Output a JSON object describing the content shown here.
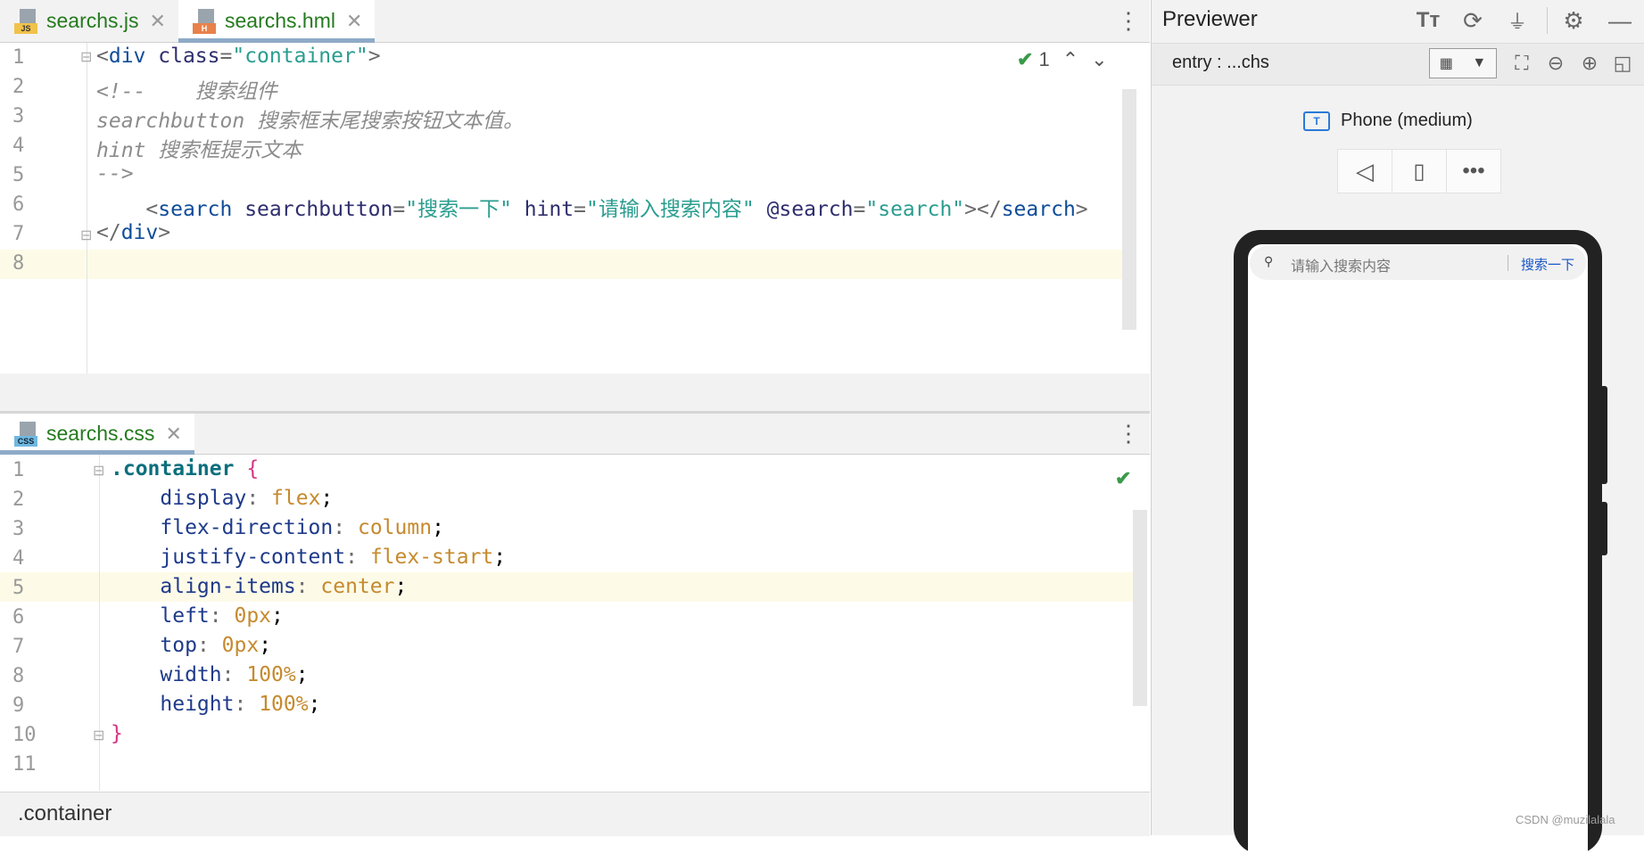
{
  "top_tabs": [
    {
      "label": "searchs.js",
      "icon": "js-file-icon",
      "badge": "JS"
    },
    {
      "label": "searchs.hml",
      "icon": "hml-file-icon",
      "badge": "H"
    }
  ],
  "top_editor": {
    "line_numbers": [
      "1",
      "2",
      "3",
      "4",
      "5",
      "6",
      "7",
      "8"
    ],
    "inspection_count": "1",
    "lines": [
      [
        "<",
        "div",
        " class",
        "=",
        "\"container\"",
        ">"
      ],
      [
        "<!--    搜索组件"
      ],
      [
        "searchbutton 搜索框末尾搜索按钮文本值。"
      ],
      [
        "hint 搜索框提示文本"
      ],
      [
        "-->"
      ],
      [
        "    <",
        "search",
        " searchbutton",
        "=",
        "\"搜索一下\"",
        " hint",
        "=",
        "\"请输入搜索内容\"",
        " @search",
        "=",
        "\"search\"",
        "></",
        "search",
        ">"
      ],
      [
        "</",
        "div",
        ">"
      ],
      [
        ""
      ]
    ]
  },
  "bottom_tabs": [
    {
      "label": "searchs.css",
      "icon": "css-file-icon",
      "badge": "CSS"
    }
  ],
  "bottom_editor": {
    "line_numbers": [
      "1",
      "2",
      "3",
      "4",
      "5",
      "6",
      "7",
      "8",
      "9",
      "10",
      "11"
    ],
    "lines": [
      [
        ".container",
        " {"
      ],
      [
        "    ",
        "display",
        ": ",
        "flex",
        ";"
      ],
      [
        "    ",
        "flex-direction",
        ": ",
        "column",
        ";"
      ],
      [
        "    ",
        "justify-content",
        ": ",
        "flex-start",
        ";"
      ],
      [
        "    ",
        "align-items",
        ": ",
        "center",
        ";"
      ],
      [
        "    ",
        "left",
        ": ",
        "0px",
        ";"
      ],
      [
        "    ",
        "top",
        ": ",
        "0px",
        ";"
      ],
      [
        "    ",
        "width",
        ": ",
        "100%",
        ";"
      ],
      [
        "    ",
        "height",
        ": ",
        "100%",
        ";"
      ],
      [
        "}"
      ],
      [
        ""
      ]
    ]
  },
  "breadcrumb": ".container",
  "previewer": {
    "title": "Previewer",
    "entry": "entry : ...chs",
    "device": "Phone (medium)",
    "search_placeholder": "请输入搜索内容",
    "search_button": "搜索一下"
  },
  "watermark": "CSDN @muzilalala",
  "colors": {
    "accent": "#1a56c8",
    "tab_text": "#247a1d",
    "check": "#3a9a4a"
  }
}
